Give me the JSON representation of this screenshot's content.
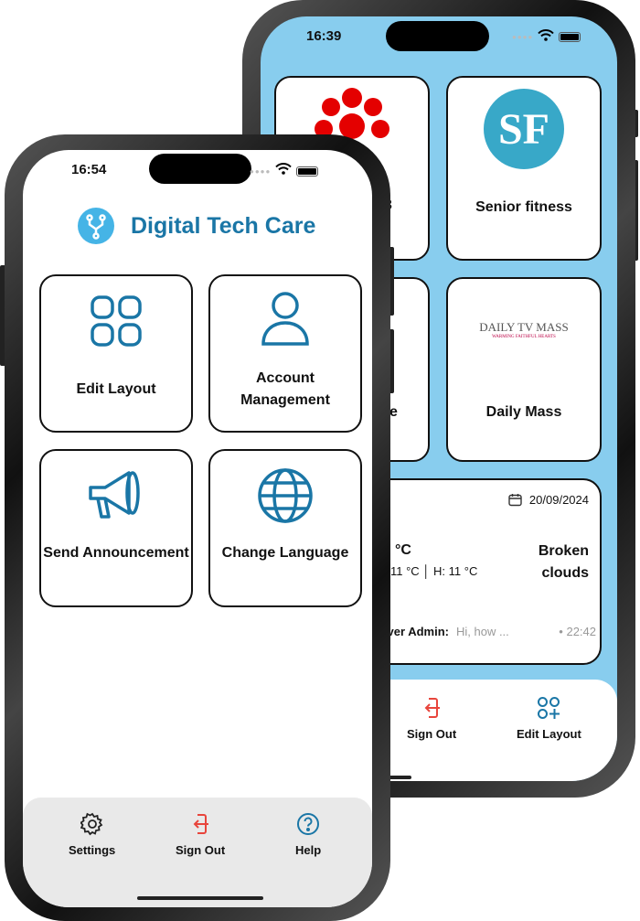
{
  "back_phone": {
    "status": {
      "time": "16:39"
    },
    "tiles": [
      {
        "label_fragment": "3",
        "icon": "cbc-gem-logo"
      },
      {
        "label": "Senior fitness",
        "icon": "sf-logo",
        "logo_text": "SF"
      },
      {
        "label_fragment": "e"
      },
      {
        "label": "Daily Mass",
        "logo_text": "DAILY TV MASS",
        "logo_tagline": "WARMING FAITHFUL HEARTS"
      }
    ],
    "widget": {
      "date": "20/09/2024",
      "temp_fragment": "°C",
      "range_fragment": "11 °C │ H: 11 °C",
      "condition": "Broken clouds",
      "message_sender_fragment": "giver Admin:",
      "message_preview": "Hi, how ...",
      "message_time": "• 22:42"
    },
    "nav": [
      {
        "label": "Sign Out",
        "icon": "sign-out-icon"
      },
      {
        "label": "Edit Layout",
        "icon": "edit-layout-icon"
      }
    ]
  },
  "front_phone": {
    "status": {
      "time": "16:54"
    },
    "app_title": "Digital Tech Care",
    "tiles": [
      {
        "label": "Edit Layout",
        "icon": "grid-icon"
      },
      {
        "label": "Account Management",
        "icon": "user-icon"
      },
      {
        "label": "Send Announcement",
        "icon": "megaphone-icon"
      },
      {
        "label": "Change Language",
        "icon": "globe-icon"
      }
    ],
    "nav": [
      {
        "label": "Settings",
        "icon": "gear-icon"
      },
      {
        "label": "Sign Out",
        "icon": "sign-out-icon"
      },
      {
        "label": "Help",
        "icon": "help-icon"
      }
    ]
  },
  "colors": {
    "brand": "#1a76a6",
    "back_bg": "#88cdee",
    "sign_out": "#e8453c",
    "front_nav_bg": "#e9e9e9"
  }
}
